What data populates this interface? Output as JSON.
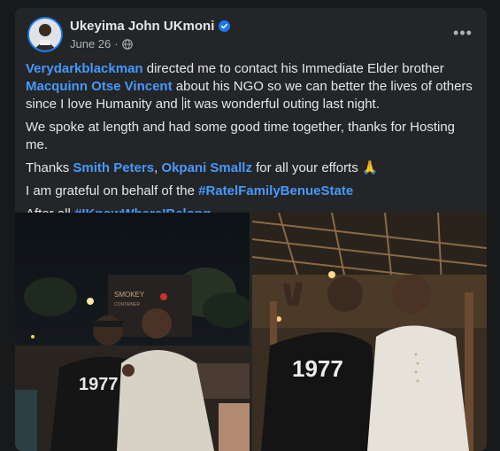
{
  "post": {
    "author": "Ukeyima John UKmoni",
    "date": "June 26",
    "dot": "·",
    "more_label": "•••",
    "paragraphs": {
      "p1": {
        "mention1": "Verydarkblackman",
        "t1": " directed me to contact his Immediate Elder brother ",
        "mention2": "Macquinn Otse Vincent",
        "t2": " about his NGO so we can better the lives of others since I love Humanity and ",
        "t3": "it was wonderful outing last night."
      },
      "p2": "We spoke at length and had some good time together, thanks for Hosting me.",
      "p3": {
        "t1": "Thanks ",
        "mention1": "Smith Peters",
        "t2": ", ",
        "mention2": "Okpani Smallz",
        "t3": " for all your efforts ",
        "emoji": "🙏"
      },
      "p4": {
        "t1": "I am grateful on behalf of the ",
        "hashtag": "#RatelFamilyBenueState"
      },
      "p5": {
        "t1": "After all ",
        "hashtag": "#IKnowWhereIBelong"
      }
    },
    "photos": {
      "photo1": {
        "sign": "SMOKEY",
        "sign_sub": "CONTAINER",
        "shirt": "1977"
      },
      "photo2": {
        "shirt": "1977"
      }
    }
  },
  "colors": {
    "background": "#18191a",
    "card": "#242526",
    "link": "#4599ff",
    "verified": "#1877f2",
    "secondary_text": "#b0b3b8"
  },
  "icons": [
    "verified-badge-icon",
    "globe-icon",
    "more-options-icon",
    "pray-emoji-icon"
  ]
}
